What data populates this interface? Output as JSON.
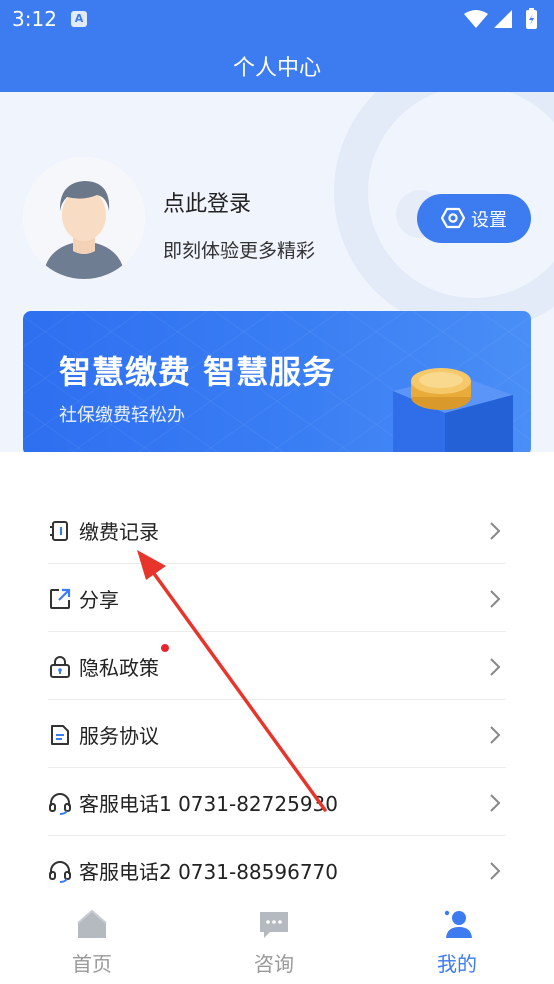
{
  "status": {
    "time": "3:12",
    "badge": "A"
  },
  "header": {
    "title": "个人中心"
  },
  "profile": {
    "login_text": "点此登录",
    "login_sub": "即刻体验更多精彩",
    "settings_label": "设置"
  },
  "banner": {
    "headline": "智慧缴费  智慧服务",
    "sub": "社保缴费轻松办"
  },
  "menu": [
    {
      "label": "缴费记录",
      "icon": "payment-record-icon"
    },
    {
      "label": "分享",
      "icon": "share-icon"
    },
    {
      "label": "隐私政策",
      "icon": "lock-icon"
    },
    {
      "label": "服务协议",
      "icon": "document-icon"
    },
    {
      "label": "客服电话1 0731-82725930",
      "icon": "headset-icon"
    },
    {
      "label": "客服电话2 0731-88596770",
      "icon": "headset-icon"
    }
  ],
  "tabs": [
    {
      "label": "首页",
      "icon": "home-icon",
      "active": false
    },
    {
      "label": "咨询",
      "icon": "chat-icon",
      "active": false
    },
    {
      "label": "我的",
      "icon": "user-icon",
      "active": true
    }
  ],
  "colors": {
    "primary": "#3d7bf1",
    "accent_red": "#e8252e"
  }
}
